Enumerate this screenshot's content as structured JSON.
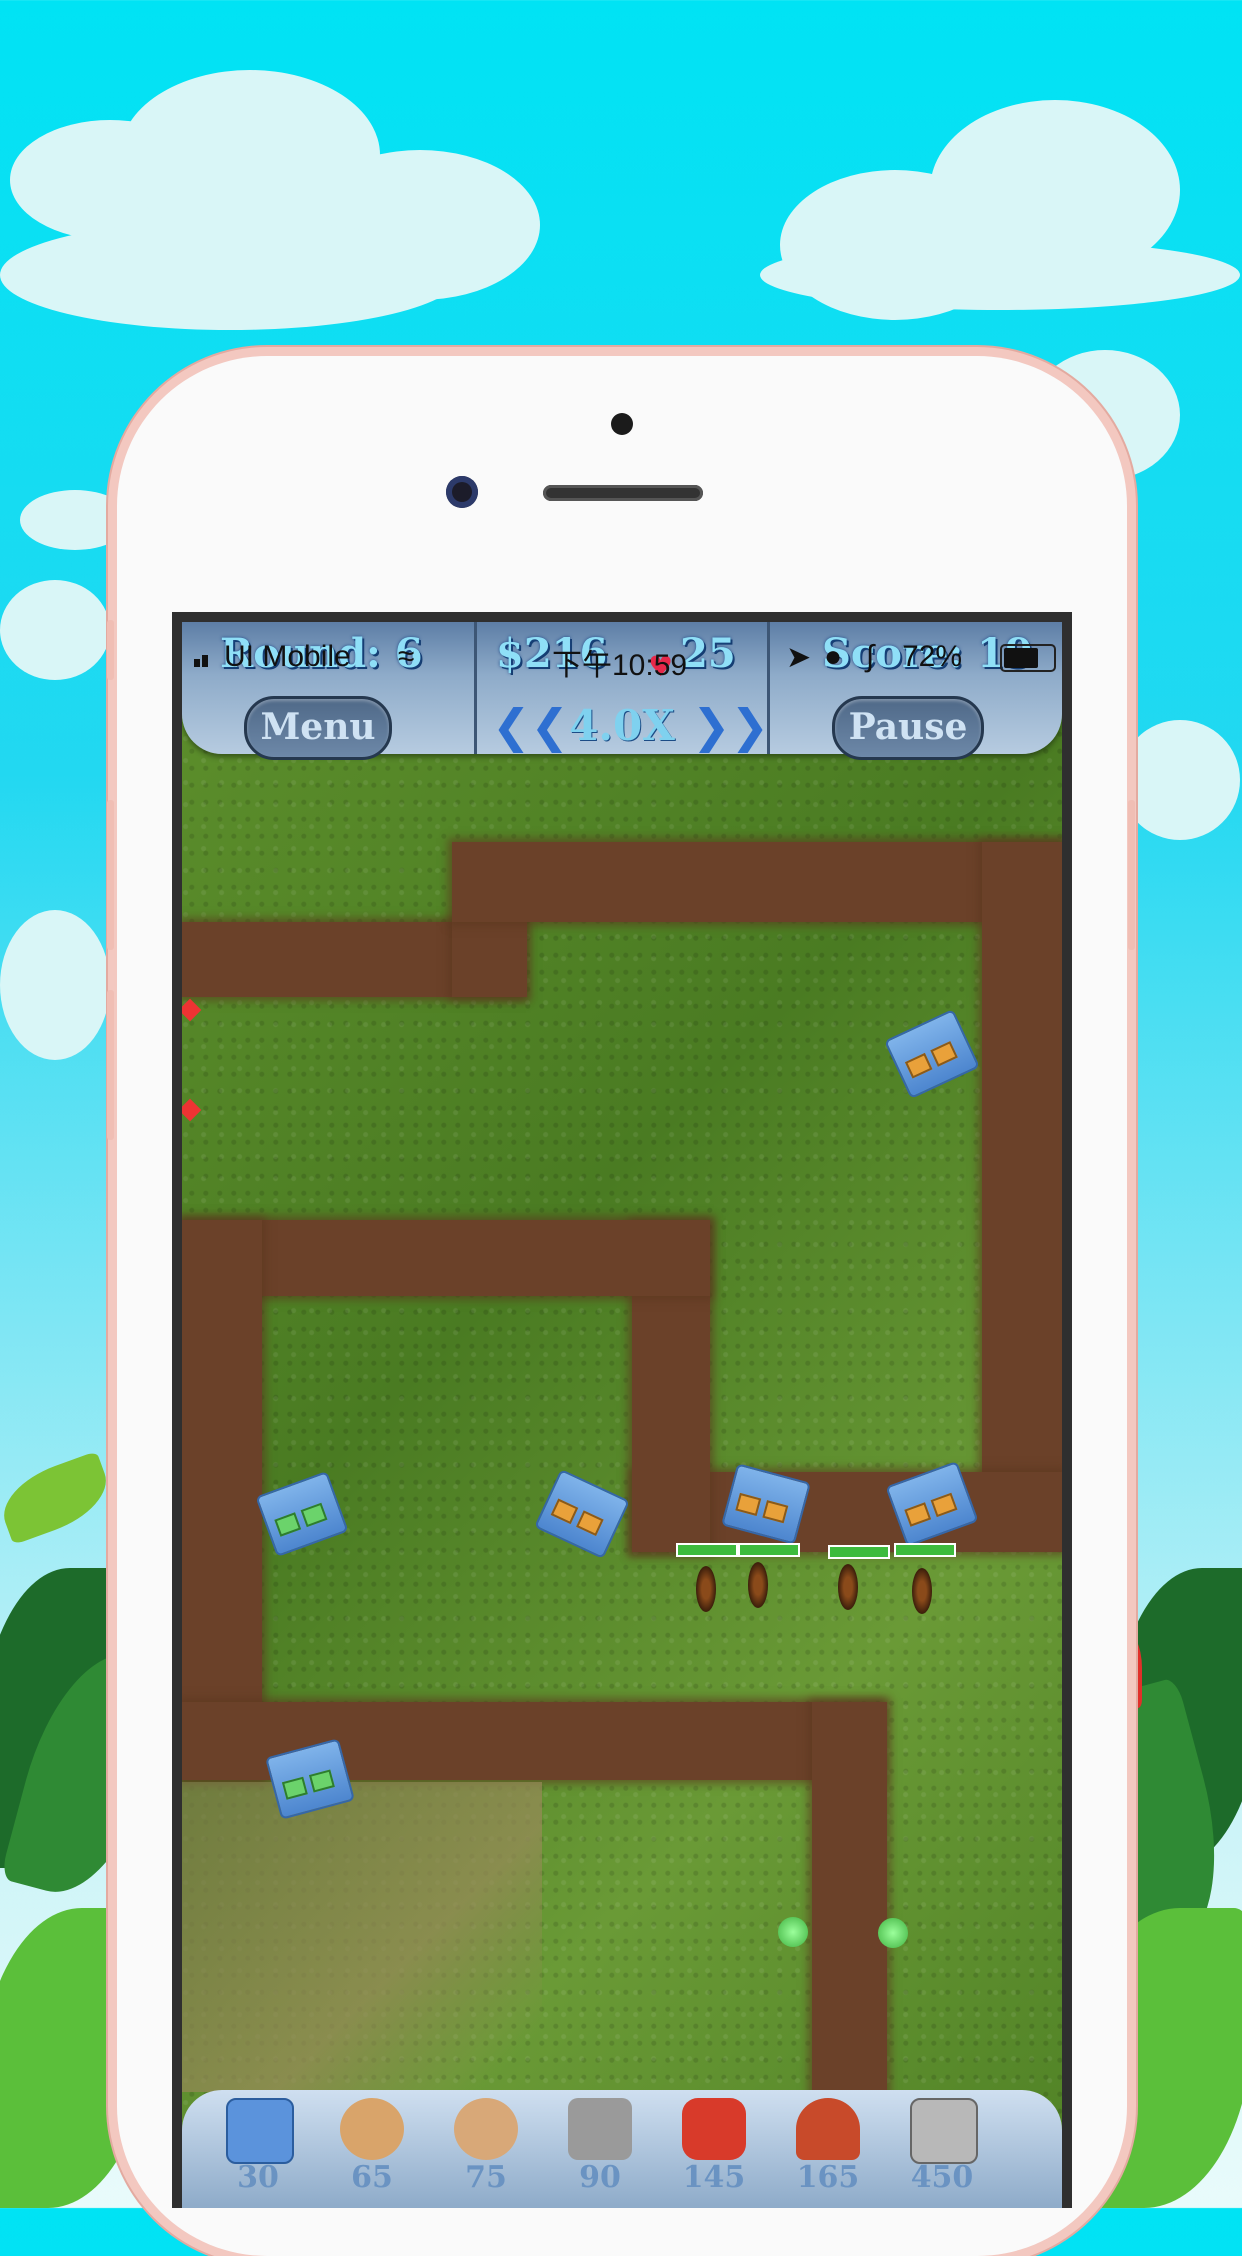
{
  "status_bar": {
    "carrier": "UI Mobile",
    "time": "下午10:59",
    "battery": "72%"
  },
  "hud": {
    "round_label": "Round: 6",
    "money_label": "$216",
    "lives_label": "25",
    "score_label": "Score: 19",
    "menu_label": "Menu",
    "speed_value": "4.0X",
    "pause_label": "Pause"
  },
  "shop": {
    "items": [
      {
        "name": "blue-box-tower",
        "price": "30",
        "color": "#5b93dc"
      },
      {
        "name": "robot-tower",
        "price": "65",
        "color": "#d9a46a"
      },
      {
        "name": "cookie-tower",
        "price": "75",
        "color": "#d8a878"
      },
      {
        "name": "grey-box-tower",
        "price": "90",
        "color": "#9a9a9a"
      },
      {
        "name": "car-tower",
        "price": "145",
        "color": "#d83a2a"
      },
      {
        "name": "ball-tower",
        "price": "165",
        "color": "#c84a2a"
      },
      {
        "name": "printer-tower",
        "price": "450",
        "color": "#b8b8b8"
      }
    ]
  }
}
